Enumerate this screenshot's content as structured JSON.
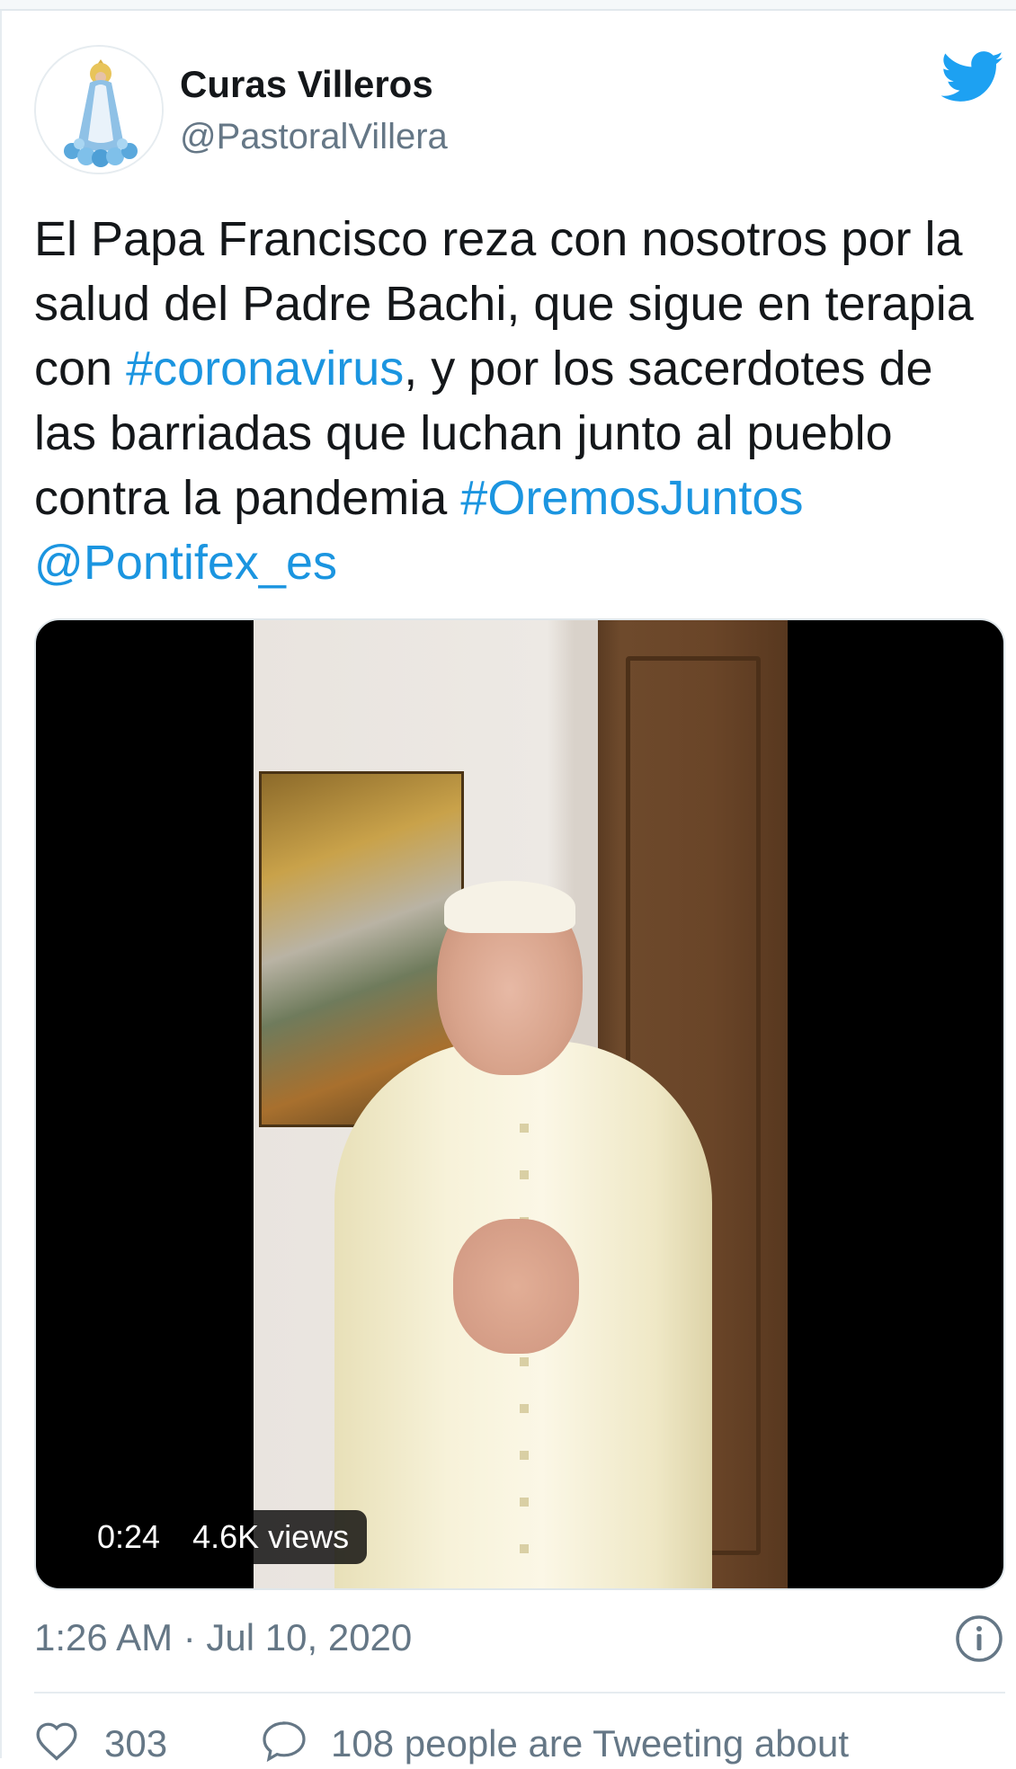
{
  "tweet": {
    "author": {
      "name": "Curas Villeros",
      "handle": "@PastoralVillera"
    },
    "text_parts": [
      {
        "text": "El Papa Francisco reza con nosotros por la salud del Padre Bachi, que sigue en terapia con ",
        "link": false
      },
      {
        "text": "#coronavirus",
        "link": true
      },
      {
        "text": ", y por los sacerdotes de las barriadas que luchan junto al pueblo contra la pandemia ",
        "link": false
      },
      {
        "text": "#OremosJuntos",
        "link": true
      },
      {
        "text": " ",
        "link": false
      },
      {
        "text": "@Pontifex_es",
        "link": true
      }
    ],
    "video": {
      "duration": "0:24",
      "views": "4.6K views"
    },
    "timestamp": "1:26 AM · Jul 10, 2020",
    "likes": "303",
    "tweeting_about": "108 people are Tweeting about"
  },
  "colors": {
    "link": "#1b95e0",
    "twitter_blue": "#1da1f2",
    "secondary_text": "#657786"
  },
  "icons": [
    "twitter-bird-icon",
    "info-icon",
    "heart-icon",
    "speech-bubble-icon"
  ]
}
